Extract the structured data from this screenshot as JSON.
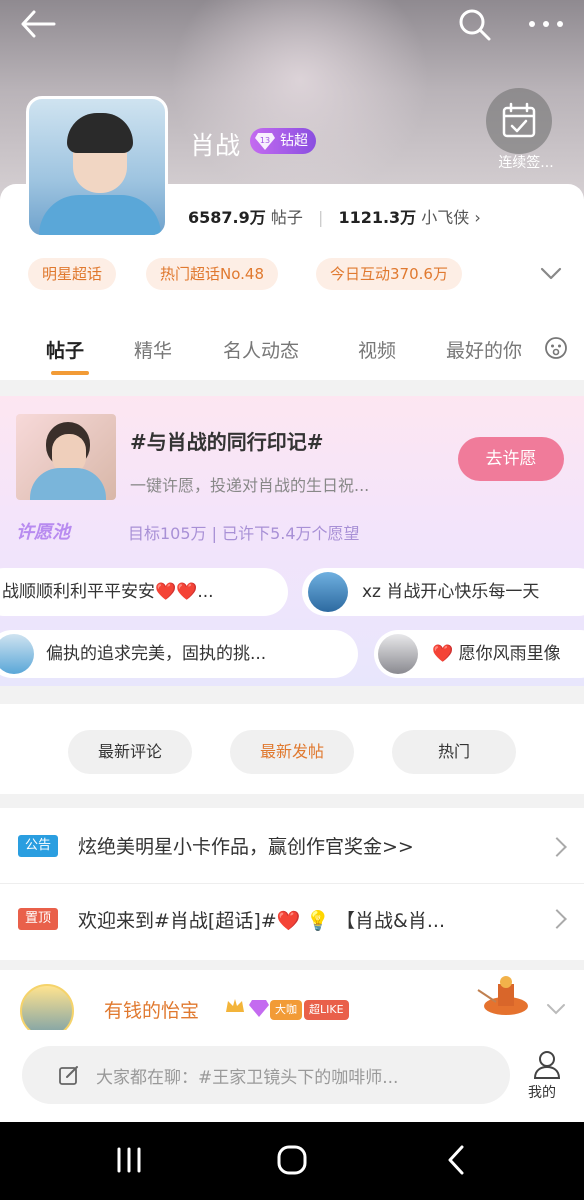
{
  "header": {
    "back_icon": "back-arrow-icon",
    "search_icon": "search-icon",
    "more_icon": "more-dots-icon"
  },
  "profile": {
    "name": "肖战",
    "badge": "钻超",
    "checkin_label": "连续签...",
    "posts_count": "6587.9万",
    "posts_label": "帖子",
    "fans_count": "1121.3万",
    "fans_label": "小飞侠"
  },
  "tags": [
    "明星超话",
    "热门超话No.48",
    "今日互动370.6万"
  ],
  "tabs": [
    "帖子",
    "精华",
    "名人动态",
    "视频",
    "最好的你"
  ],
  "wish": {
    "title": "#与肖战的同行印记#",
    "subtitle": "一键许愿，投递对肖战的生日祝...",
    "button": "去许愿",
    "logo": "许愿池",
    "target": "目标105万 | 已许下5.4万个愿望",
    "bubbles": [
      {
        "text": "战顺顺利利平平安安❤️❤️..."
      },
      {
        "text": "xz  肖战开心快乐每一天"
      },
      {
        "text": "偏执的追求完美，固执的挑..."
      },
      {
        "text": "❤️ 愿你风雨里像"
      }
    ]
  },
  "filters": [
    "最新评论",
    "最新发帖",
    "热门"
  ],
  "notices": [
    {
      "badge": "公告",
      "text": "炫绝美明星小卡作品，赢创作官奖金>>",
      "color": "#2a9ee0"
    },
    {
      "badge": "置顶",
      "text": "欢迎来到#肖战[超话]#❤️ 💡 【肖战&肖...",
      "color": "#e9604a"
    }
  ],
  "post": {
    "author": "有钱的怡宝",
    "badge_big": "大咖",
    "badge_like": "超LIKE"
  },
  "compose": {
    "placeholder": "大家都在聊：#王家卫镜头下的咖啡师...",
    "me_label": "我的"
  },
  "colors": {
    "accent": "#f29b36",
    "tag_bg": "#fdeee5",
    "wish_button": "#f07b9a"
  }
}
